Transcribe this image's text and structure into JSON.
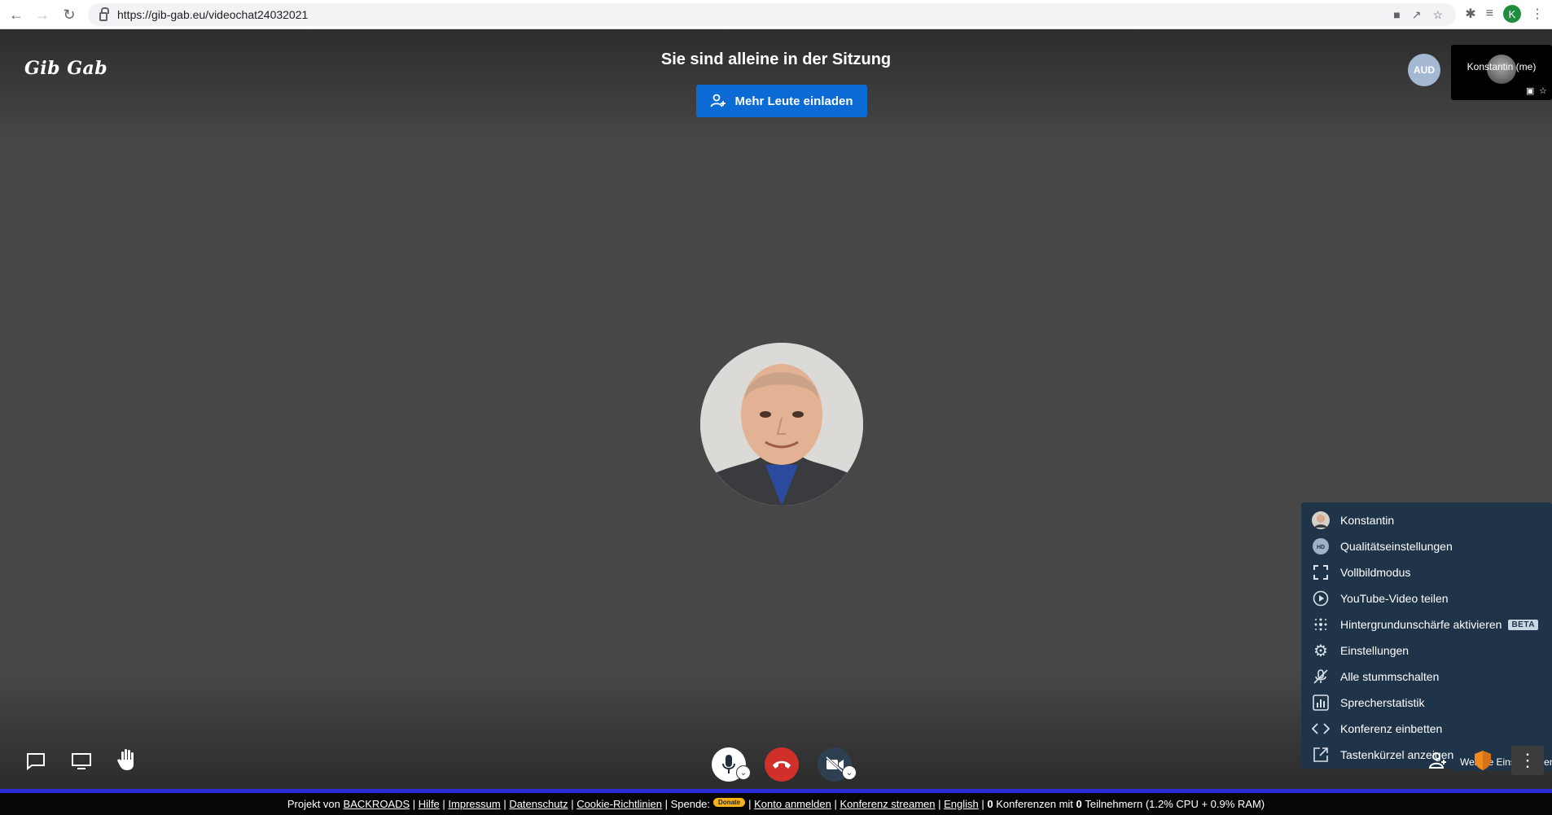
{
  "browser": {
    "url": "https://gib-gab.eu/videochat24032021",
    "profile_initial": "K"
  },
  "app": {
    "logo": "Gib Gab",
    "headline": "Sie sind alleine in der Sitzung",
    "invite_label": "Mehr Leute einladen",
    "aud_avatar": "AUD",
    "self_tile_name": "Konstantin (me)"
  },
  "menu": {
    "items": [
      {
        "label": "Konstantin",
        "icon": "avatar"
      },
      {
        "label": "Qualitätseinstellungen",
        "icon": "hd-icon"
      },
      {
        "label": "Vollbildmodus",
        "icon": "fullscreen-icon"
      },
      {
        "label": "YouTube-Video teilen",
        "icon": "play-icon"
      },
      {
        "label": "Hintergrundunschärfe aktivieren",
        "icon": "blur-icon",
        "badge": "BETA"
      },
      {
        "label": "Einstellungen",
        "icon": "gear-icon"
      },
      {
        "label": "Alle stummschalten",
        "icon": "mic-off-icon"
      },
      {
        "label": "Sprecherstatistik",
        "icon": "stats-icon"
      },
      {
        "label": "Konferenz einbetten",
        "icon": "code-icon"
      },
      {
        "label": "Tastenkürzel anzeigen",
        "icon": "external-icon"
      }
    ],
    "tooltip": "Weitere Einstellungen"
  },
  "footer": {
    "prefix": "Projekt von",
    "backroads": "BACKROADS",
    "hilfe": "Hilfe",
    "impressum": "Impressum",
    "datenschutz": "Datenschutz",
    "cookie": "Cookie-Richtlinien",
    "spende": "Spende:",
    "donate": "Donate",
    "konto": "Konto anmelden",
    "streamen": "Konferenz streamen",
    "english": "English",
    "stats_conf_count": "0",
    "stats_mid1": "Konferenzen mit",
    "stats_part_count": "0",
    "stats_mid2": "Teilnehmern",
    "stats_usage": "(1.2% CPU + 0.9% RAM)"
  },
  "colors": {
    "invite_blue": "#0b6ad3",
    "hangup_red": "#d1302a",
    "menu_bg": "#1f3448",
    "security_orange": "#f08a1c"
  }
}
